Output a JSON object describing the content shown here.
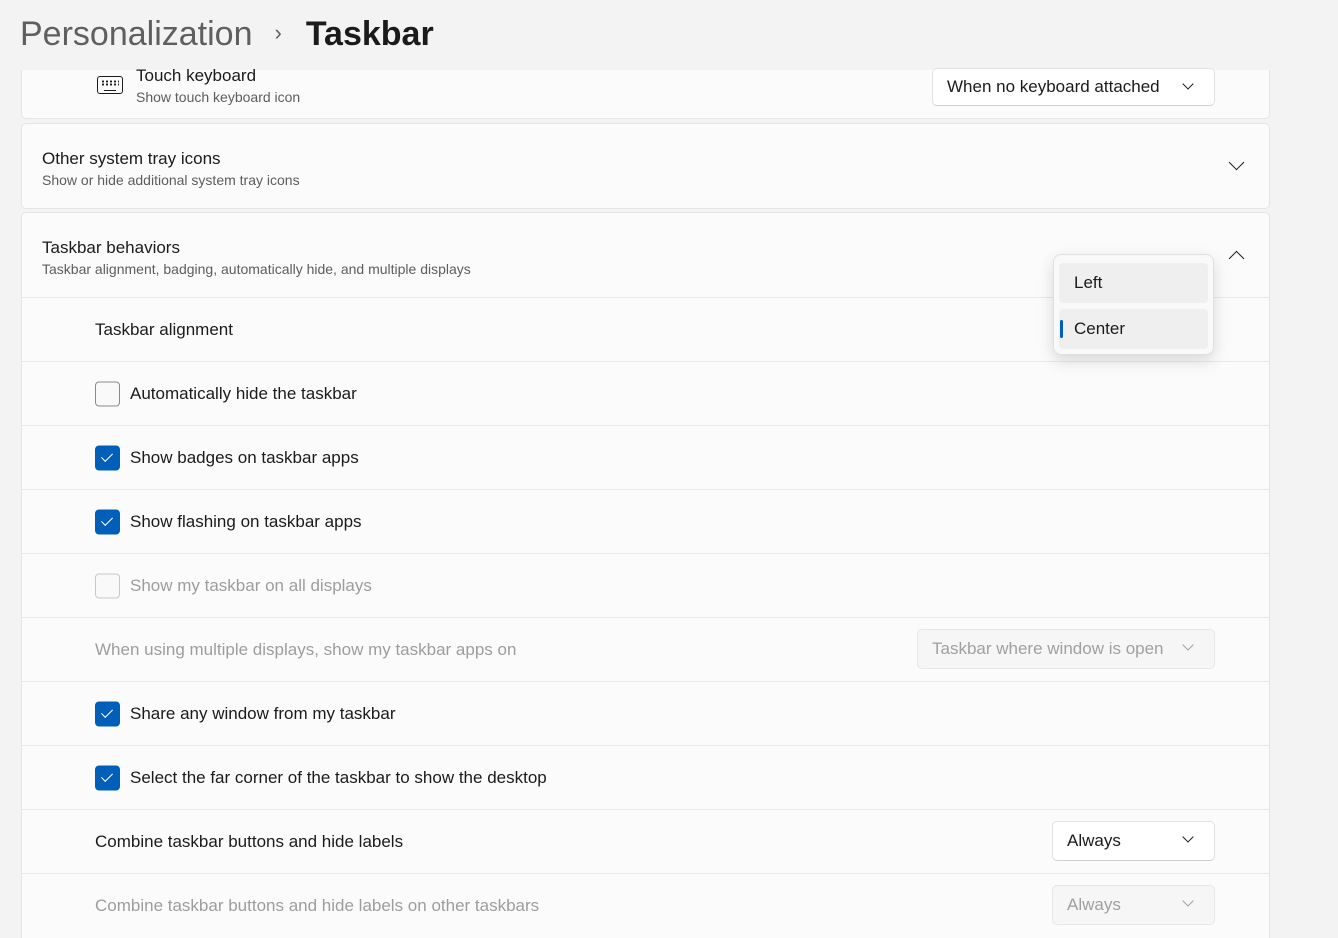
{
  "breadcrumb": {
    "parent": "Personalization",
    "separator": "›",
    "current": "Taskbar"
  },
  "touch_keyboard": {
    "title": "Touch keyboard",
    "subtitle": "Show touch keyboard icon",
    "dropdown_value": "When no keyboard attached",
    "icon": "keyboard-icon"
  },
  "other_tray": {
    "title": "Other system tray icons",
    "subtitle": "Show or hide additional system tray icons",
    "expanded": false
  },
  "behaviors": {
    "title": "Taskbar behaviors",
    "subtitle": "Taskbar alignment, badging, automatically hide, and multiple displays",
    "expanded": true,
    "alignment": {
      "label": "Taskbar alignment",
      "options": [
        "Left",
        "Center"
      ],
      "selected": "Center"
    },
    "auto_hide": {
      "label": "Automatically hide the taskbar",
      "checked": false
    },
    "badges": {
      "label": "Show badges on taskbar apps",
      "checked": true
    },
    "flashing": {
      "label": "Show flashing on taskbar apps",
      "checked": true
    },
    "all_displays": {
      "label": "Show my taskbar on all displays",
      "checked": false,
      "disabled": true
    },
    "multi_display": {
      "label": "When using multiple displays, show my taskbar apps on",
      "value": "Taskbar where window is open",
      "disabled": true
    },
    "share_window": {
      "label": "Share any window from my taskbar",
      "checked": true
    },
    "far_corner": {
      "label": "Select the far corner of the taskbar to show the desktop",
      "checked": true
    },
    "combine": {
      "label": "Combine taskbar buttons and hide labels",
      "value": "Always"
    },
    "combine_other": {
      "label": "Combine taskbar buttons and hide labels on other taskbars",
      "value": "Always",
      "disabled": true
    }
  },
  "colors": {
    "accent": "#005fb8",
    "background": "#f3f3f3",
    "card": "#fbfbfb"
  }
}
